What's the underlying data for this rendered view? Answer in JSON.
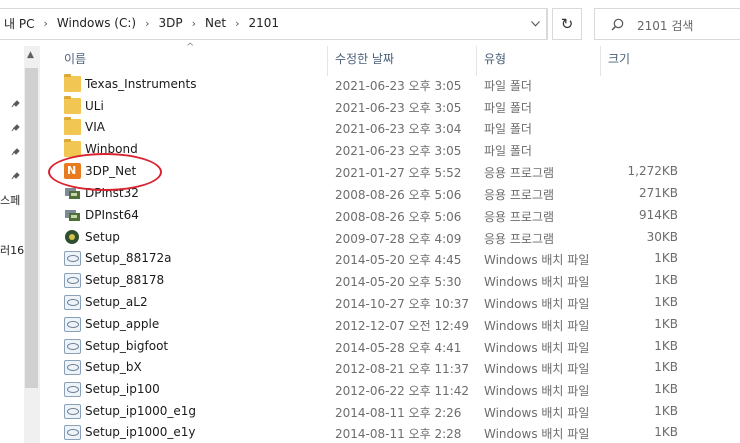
{
  "address_bar": {
    "crumbs": [
      "내 PC",
      "Windows (C:)",
      "3DP",
      "Net",
      "2101"
    ],
    "separator": "›"
  },
  "search": {
    "placeholder": "2101 검색"
  },
  "nav": {
    "partial_labels": [
      "스페",
      "러16"
    ]
  },
  "columns": {
    "name": "이름",
    "date": "수정한 날짜",
    "type": "유형",
    "size": "크기"
  },
  "rows": [
    {
      "name": "Texas_Instruments",
      "date": "2021-06-23 오후 3:05",
      "type": "파일 폴더",
      "size": "",
      "icon": "folder-icon"
    },
    {
      "name": "ULi",
      "date": "2021-06-23 오후 3:05",
      "type": "파일 폴더",
      "size": "",
      "icon": "folder-icon"
    },
    {
      "name": "VIA",
      "date": "2021-06-23 오후 3:04",
      "type": "파일 폴더",
      "size": "",
      "icon": "folder-icon"
    },
    {
      "name": "Winbond",
      "date": "2021-06-23 오후 3:05",
      "type": "파일 폴더",
      "size": "",
      "icon": "folder-icon"
    },
    {
      "name": "3DP_Net",
      "date": "2021-01-27 오후 5:52",
      "type": "응용 프로그램",
      "size": "1,272KB",
      "icon": "3dp-net-app-icon"
    },
    {
      "name": "DPInst32",
      "date": "2008-08-26 오후 5:06",
      "type": "응용 프로그램",
      "size": "271KB",
      "icon": "dpinst-app-icon"
    },
    {
      "name": "DPInst64",
      "date": "2008-08-26 오후 5:06",
      "type": "응용 프로그램",
      "size": "914KB",
      "icon": "dpinst-app-icon"
    },
    {
      "name": "Setup",
      "date": "2009-07-28 오후 4:09",
      "type": "응용 프로그램",
      "size": "30KB",
      "icon": "setup-app-icon"
    },
    {
      "name": "Setup_88172a",
      "date": "2014-05-20 오후 4:45",
      "type": "Windows 배치 파일",
      "size": "1KB",
      "icon": "batch-file-icon"
    },
    {
      "name": "Setup_88178",
      "date": "2014-05-20 오후 5:30",
      "type": "Windows 배치 파일",
      "size": "1KB",
      "icon": "batch-file-icon"
    },
    {
      "name": "Setup_aL2",
      "date": "2014-10-27 오후 10:37",
      "type": "Windows 배치 파일",
      "size": "1KB",
      "icon": "batch-file-icon"
    },
    {
      "name": "Setup_apple",
      "date": "2012-12-07 오전 12:49",
      "type": "Windows 배치 파일",
      "size": "1KB",
      "icon": "batch-file-icon"
    },
    {
      "name": "Setup_bigfoot",
      "date": "2014-05-28 오후 4:41",
      "type": "Windows 배치 파일",
      "size": "1KB",
      "icon": "batch-file-icon"
    },
    {
      "name": "Setup_bX",
      "date": "2012-08-21 오후 11:37",
      "type": "Windows 배치 파일",
      "size": "1KB",
      "icon": "batch-file-icon"
    },
    {
      "name": "Setup_ip100",
      "date": "2012-06-22 오후 11:42",
      "type": "Windows 배치 파일",
      "size": "1KB",
      "icon": "batch-file-icon"
    },
    {
      "name": "Setup_ip1000_e1g",
      "date": "2014-08-11 오후 2:26",
      "type": "Windows 배치 파일",
      "size": "1KB",
      "icon": "batch-file-icon"
    },
    {
      "name": "Setup_ip1000_e1y",
      "date": "2014-08-11 오후 2:28",
      "type": "Windows 배치 파일",
      "size": "1KB",
      "icon": "batch-file-icon"
    }
  ],
  "annotation": {
    "highlight_color": "#d9232e"
  }
}
